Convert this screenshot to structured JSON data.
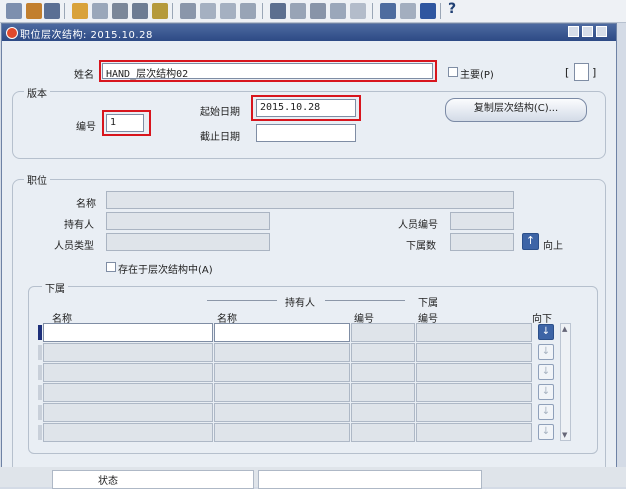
{
  "toolbar": {
    "icons": [
      "save-icon",
      "nav-icon",
      "refresh-icon",
      "print-icon",
      "clear-icon",
      "delete-icon",
      "find-icon",
      "undo-icon",
      "cut-icon",
      "copy-icon",
      "paste-icon",
      "clear-field-icon",
      "edit-icon",
      "attach-icon",
      "folder-icon",
      "globe-icon",
      "link-icon",
      "wrench-icon",
      "calendar-icon",
      "window-icon",
      "exit-icon",
      "help-icon"
    ],
    "help_label": "?"
  },
  "window": {
    "title": "职位层次结构: 2015.10.28"
  },
  "header": {
    "name_label": "姓名",
    "name_value": "HAND_层次结构02",
    "primary_label": "主要(P)",
    "bracket_label": "[",
    "bracket_end": "]"
  },
  "version": {
    "group_title": "版本",
    "number_label": "编号",
    "number_value": "1",
    "start_date_label": "起始日期",
    "start_date_value": "2015.10.28",
    "end_date_label": "截止日期",
    "end_date_value": "",
    "copy_button": "复制层次结构(C)..."
  },
  "position": {
    "group_title": "职位",
    "name_label": "名称",
    "holder_label": "持有人",
    "staff_no_label": "人员编号",
    "staff_type_label": "人员类型",
    "subordinates_label": "下属数",
    "up_label": "向上",
    "exists_label": "存在于层次结构中(A)"
  },
  "subordinates": {
    "group_title": "下属",
    "holder_header": "持有人",
    "sub_header": "下属",
    "columns": [
      "名称",
      "名称",
      "编号",
      "编号",
      "向下"
    ],
    "row_count": 6
  },
  "status_bar": {
    "text": "状态"
  }
}
